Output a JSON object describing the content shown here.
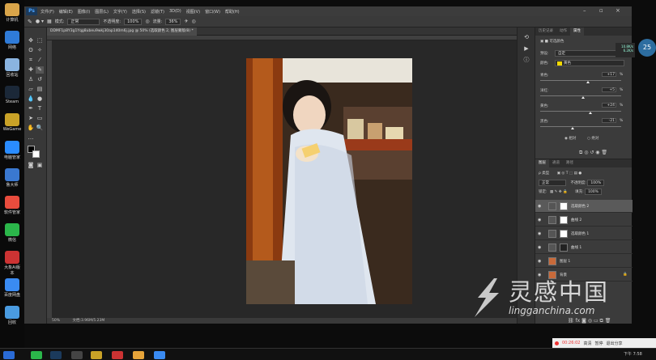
{
  "desktop": {
    "icons": [
      {
        "label": "计算机",
        "icon": "computer-icon",
        "color": "#d9a54a"
      },
      {
        "label": "网络",
        "icon": "network-icon",
        "color": "#2f7bd8"
      },
      {
        "label": "回收站",
        "icon": "recycle-bin-icon",
        "color": "#8ab4e0"
      },
      {
        "label": "Steam",
        "icon": "steam-icon",
        "color": "#1b2838"
      },
      {
        "label": "WeGame",
        "icon": "wegame-icon",
        "color": "#c9a227"
      },
      {
        "label": "电脑管家",
        "icon": "pc-manager-icon",
        "color": "#2a8cff"
      },
      {
        "label": "鲁大师",
        "icon": "ludashi-icon",
        "color": "#3a78d0"
      },
      {
        "label": "软件管家",
        "icon": "software-manager-icon",
        "color": "#e94c3d"
      },
      {
        "label": "微信",
        "icon": "wechat-icon",
        "color": "#2bb64a"
      },
      {
        "label": "大象Ai版本",
        "icon": "app-icon",
        "color": "#c33"
      },
      {
        "label": "百度网盘",
        "icon": "baidu-pan-icon",
        "color": "#3a8bf2"
      },
      {
        "label": "回收",
        "icon": "folder-icon",
        "color": "#4a9be0"
      }
    ]
  },
  "photoshop": {
    "app_badge": "Ps",
    "menu": [
      "文件(F)",
      "编辑(E)",
      "图像(I)",
      "图层(L)",
      "文字(Y)",
      "选择(S)",
      "滤镜(T)",
      "3D(D)",
      "视图(V)",
      "窗口(W)",
      "帮助(H)"
    ],
    "options": {
      "mode_label": "模式:",
      "mode_value": "正常",
      "opacity_label": "不透明度:",
      "opacity_value": "100%",
      "flow_label": "流量:",
      "flow_value": "36%"
    },
    "document_tab": "DDMF1p8Y3g1Yqg8ubeu9wkj30ap140m6j.jpg @ 50% (选取颜色 2, 图层蒙版/8) *",
    "status": {
      "zoom": "50%",
      "doc": "文档:3.96M/5.23M"
    },
    "panel_tabs": {
      "history": "历史记录",
      "actions": "动作",
      "properties": "属性"
    },
    "properties": {
      "title": "可选颜色",
      "preset_label": "预设:",
      "preset_value": "自定",
      "colors_label": "颜色:",
      "colors_value": "黄色",
      "colors_swatch": "#f2d900",
      "sliders": [
        {
          "label": "青色:",
          "value": "+17",
          "unit": "%",
          "position": 0.585
        },
        {
          "label": "洋红:",
          "value": "+5",
          "unit": "%",
          "position": 0.525
        },
        {
          "label": "黄色:",
          "value": "+24",
          "unit": "%",
          "position": 0.62
        },
        {
          "label": "黑色:",
          "value": "-21",
          "unit": "%",
          "position": 0.395
        }
      ],
      "method_relative": "相对",
      "method_absolute": "绝对"
    },
    "layers_panel": {
      "tabs": [
        "图层",
        "通道",
        "路径"
      ],
      "filter_label": "ρ 类型",
      "blend_mode": "正常",
      "opacity_label": "不透明度:",
      "opacity_value": "100%",
      "lock_label": "锁定:",
      "fill_label": "填充:",
      "fill_value": "100%",
      "layers": [
        {
          "name": "选取颜色 2",
          "selected": true,
          "adjust": true,
          "mask": "#ffffff"
        },
        {
          "name": "曲线 2",
          "selected": false,
          "adjust": true,
          "mask": "#ffffff"
        },
        {
          "name": "选取颜色 1",
          "selected": false,
          "adjust": true,
          "mask": "#ffffff"
        },
        {
          "name": "曲线 1",
          "selected": false,
          "adjust": true,
          "mask": "#222222"
        },
        {
          "name": "图层 1",
          "selected": false,
          "adjust": false,
          "mask": ""
        },
        {
          "name": "背景",
          "selected": false,
          "adjust": false,
          "mask": ""
        }
      ]
    }
  },
  "overlay": {
    "badge": "25",
    "net_up": "10.8K/s",
    "net_down": "6.2K/s",
    "watermark_title": "灵感中国",
    "watermark_url": "lingganchina.com",
    "recording": {
      "time": "00:26:02",
      "btn1": "高清",
      "btn2": "暂停",
      "btn3": "退出分享"
    }
  },
  "taskbar": {
    "clock": "下午 7:58"
  }
}
